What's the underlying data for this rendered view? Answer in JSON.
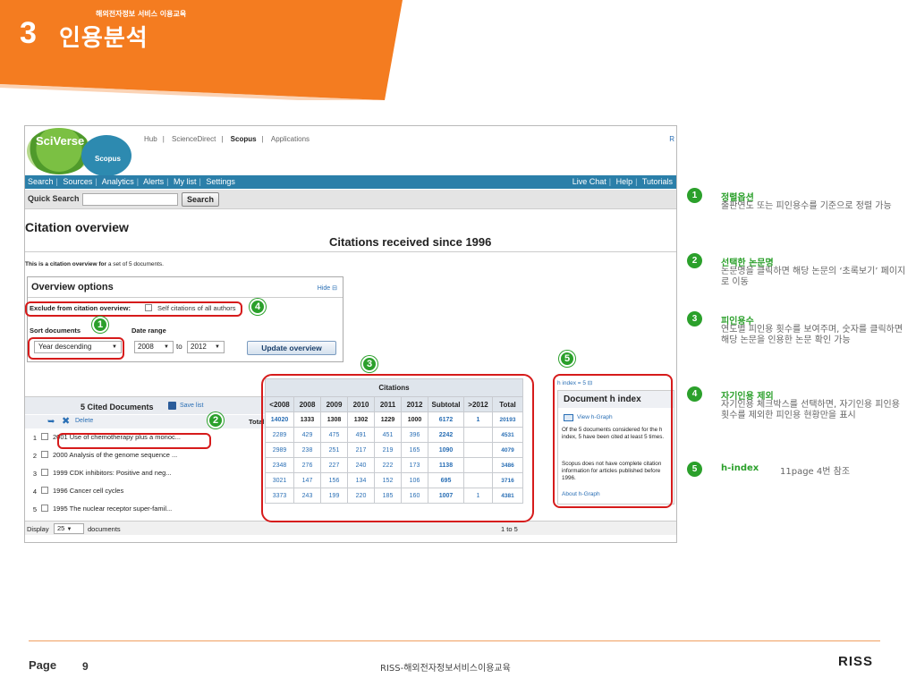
{
  "header": {
    "section_number": "3",
    "section_title": "인용분석",
    "section_subtitle": "해외전자정보 서비스 이용교육",
    "banner_color": "#f47c20"
  },
  "screenshot": {
    "logo_text": "SciVerse",
    "scopus_label": "Scopus",
    "top_nav": [
      "Hub",
      "ScienceDirect",
      "Scopus",
      "Applications"
    ],
    "top_nav_separator": "|",
    "top_right_text": "R",
    "nav_left": [
      "Search",
      "Sources",
      "Analytics",
      "Alerts",
      "My list",
      "Settings"
    ],
    "nav_right": [
      "Live Chat",
      "Help",
      "Tutorials"
    ],
    "nav_separator": "|",
    "quick_search_label": "Quick Search",
    "search_button": "Search",
    "citation_overview_title": "Citation overview",
    "citations_received": "Citations received since 1996",
    "overview_note_bold": "This is a citation overview for",
    "overview_note_rest": "a set of 5 documents.",
    "overview_options": {
      "title": "Overview options",
      "hide_label": "Hide ⊟",
      "exclude_label": "Exclude from citation overview:",
      "self_citations_label": "Self citations of all authors",
      "sort_label": "Sort documents",
      "sort_value": "Year descending",
      "date_range_label": "Date range",
      "from_year": "2008",
      "to_label": "to",
      "to_year": "2012",
      "update_button": "Update overview"
    },
    "documents": {
      "title": "5 Cited Documents",
      "save_list": "Save list",
      "delete_label": "Delete",
      "total_label": "Total",
      "rows": [
        {
          "num": "1",
          "text": "2001 Use of chemotherapy plus a monoc..."
        },
        {
          "num": "2",
          "text": "2000 Analysis of the genome sequence ..."
        },
        {
          "num": "3",
          "text": "1999 CDK inhibitors: Positive and neg..."
        },
        {
          "num": "4",
          "text": "1996 Cancer cell cycles"
        },
        {
          "num": "5",
          "text": "1995 The nuclear receptor super-famil..."
        }
      ],
      "display_label": "Display",
      "display_value": "25",
      "display_docs": "documents",
      "page_range": "1 to 5"
    },
    "citations_table": {
      "caption": "Citations",
      "headers": [
        "<2008",
        "2008",
        "2009",
        "2010",
        "2011",
        "2012",
        "Subtotal",
        ">2012",
        "Total"
      ],
      "total_row": [
        "14020",
        "1333",
        "1308",
        "1302",
        "1229",
        "1000",
        "6172",
        "1",
        "20193"
      ],
      "rows": [
        [
          "2289",
          "429",
          "475",
          "491",
          "451",
          "396",
          "2242",
          "",
          "4531"
        ],
        [
          "2989",
          "238",
          "251",
          "217",
          "219",
          "165",
          "1090",
          "",
          "4079"
        ],
        [
          "2348",
          "276",
          "227",
          "240",
          "222",
          "173",
          "1138",
          "",
          "3486"
        ],
        [
          "3021",
          "147",
          "156",
          "134",
          "152",
          "106",
          "695",
          "",
          "3716"
        ],
        [
          "3373",
          "243",
          "199",
          "220",
          "185",
          "160",
          "1007",
          "1",
          "4381"
        ]
      ]
    },
    "h_index": {
      "link": "h index = 5 ⊟",
      "title": "Document h index",
      "view_graph": "View h-Graph",
      "desc1": "Of the 5 documents considered for the h index, 5 have been cited at least 5 times.",
      "desc2": "Scopus does not have complete citation information for articles published before 1996.",
      "about": "About h-Graph"
    },
    "markers": [
      "1",
      "2",
      "3",
      "4",
      "5"
    ]
  },
  "notes": [
    {
      "num": "1",
      "title": "정렬옵션",
      "desc": "출판연도 또는 피인용수를 기준으로 정렬 가능"
    },
    {
      "num": "2",
      "title": "선택한 논문명",
      "desc": "논문명을 클릭하면 해당 논문의 ‘초록보기’ 페이지로 이동"
    },
    {
      "num": "3",
      "title": "피인용수",
      "desc": "연도별 피인용 횟수를 보여주며, 숫자를 클릭하면 해당 논문을 인용한 논문 확인 가능"
    },
    {
      "num": "4",
      "title": "자기인용 제외",
      "desc": "자기인용 체크박스를 선택하면, 자기인용 피인용 횟수를 제외한 피인용 현황만을 표시"
    },
    {
      "num": "5",
      "title": "h-index",
      "desc": "11page 4번 참조"
    }
  ],
  "footer": {
    "page_label": "Page",
    "page_number": "9",
    "center_text": "RISS-해외전자정보서비스이용교육",
    "logo": "RISS"
  },
  "colors": {
    "accent_green": "#2ba02b",
    "highlight_red": "#d61b1b",
    "nav_blue": "#2b7fa9"
  }
}
